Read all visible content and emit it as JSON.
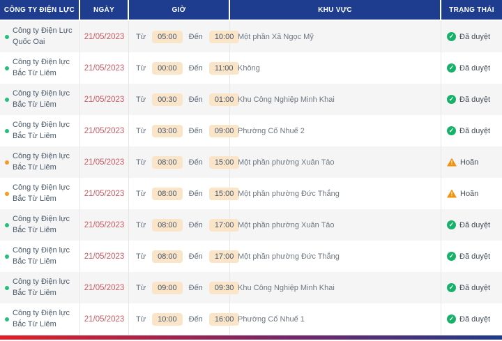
{
  "colors": {
    "header_bg": "#1e3d8f",
    "header_text": "#ffffff",
    "date_text": "#cd5a62",
    "time_chip_bg": "#fae5c8",
    "time_chip_text": "#44566c",
    "row_alt_bg": "#f5f5f6",
    "approved_green": "#17b26a",
    "dot_green": "#22c07a",
    "postponed_orange": "#f2930d",
    "dot_orange": "#f59a23",
    "gradient_left": "#e41e25",
    "gradient_mid": "#7b2566",
    "gradient_right": "#1e3a8d"
  },
  "table": {
    "columns": [
      {
        "key": "company",
        "label": "CÔNG TY ĐIỆN LỰC"
      },
      {
        "key": "date",
        "label": "NGÀY"
      },
      {
        "key": "time",
        "label": "GIỜ"
      },
      {
        "key": "area",
        "label": "KHU VỰC"
      },
      {
        "key": "status",
        "label": "TRẠNG THÁI"
      }
    ],
    "time_from_label": "Từ",
    "time_to_label": "Đến",
    "statuses": {
      "approved": {
        "label": "Đã duyệt",
        "icon": "check-circle-icon"
      },
      "postponed": {
        "label": "Hoãn",
        "icon": "warning-triangle-icon"
      }
    },
    "rows": [
      {
        "company": "Công ty Điện Lực Quốc Oai",
        "dot": "green",
        "date": "21/05/2023",
        "from": "05:00",
        "to": "10:00",
        "area": "Một phần Xã Ngọc Mỹ",
        "status": "approved"
      },
      {
        "company": "Công ty Điện lực Bắc Từ Liêm",
        "dot": "green",
        "date": "21/05/2023",
        "from": "00:00",
        "to": "11:00",
        "area": "Không",
        "status": "approved"
      },
      {
        "company": "Công ty Điện lực Bắc Từ Liêm",
        "dot": "green",
        "date": "21/05/2023",
        "from": "00:30",
        "to": "01:00",
        "area": "Khu Công Nghiệp Minh Khai",
        "status": "approved"
      },
      {
        "company": "Công ty Điện lực Bắc Từ Liêm",
        "dot": "green",
        "date": "21/05/2023",
        "from": "03:00",
        "to": "09:00",
        "area": "Phường Cố Nhuế 2",
        "status": "approved"
      },
      {
        "company": "Công ty Điện lực Bắc Từ Liêm",
        "dot": "orange",
        "date": "21/05/2023",
        "from": "08:00",
        "to": "15:00",
        "area": "Một phần phường Xuân Tảo",
        "status": "postponed"
      },
      {
        "company": "Công ty Điện lực Bắc Từ Liêm",
        "dot": "orange",
        "date": "21/05/2023",
        "from": "08:00",
        "to": "15:00",
        "area": "Một phần phường Đức Thắng",
        "status": "postponed"
      },
      {
        "company": "Công ty Điện lực Bắc Từ Liêm",
        "dot": "green",
        "date": "21/05/2023",
        "from": "08:00",
        "to": "17:00",
        "area": "Một phần phường Xuân Tảo",
        "status": "approved"
      },
      {
        "company": "Công ty Điện lực Bắc Từ Liêm",
        "dot": "green",
        "date": "21/05/2023",
        "from": "08:00",
        "to": "17:00",
        "area": "Một phần phường Đức Thắng",
        "status": "approved"
      },
      {
        "company": "Công ty Điện lực Bắc Từ Liêm",
        "dot": "green",
        "date": "21/05/2023",
        "from": "09:00",
        "to": "09:30",
        "area": "Khu Công Nghiệp Minh Khai",
        "status": "approved"
      },
      {
        "company": "Công ty Điện lực Bắc Từ Liêm",
        "dot": "green",
        "date": "21/05/2023",
        "from": "10:00",
        "to": "16:00",
        "area": "Phường Cố Nhuế 1",
        "status": "approved"
      }
    ]
  }
}
